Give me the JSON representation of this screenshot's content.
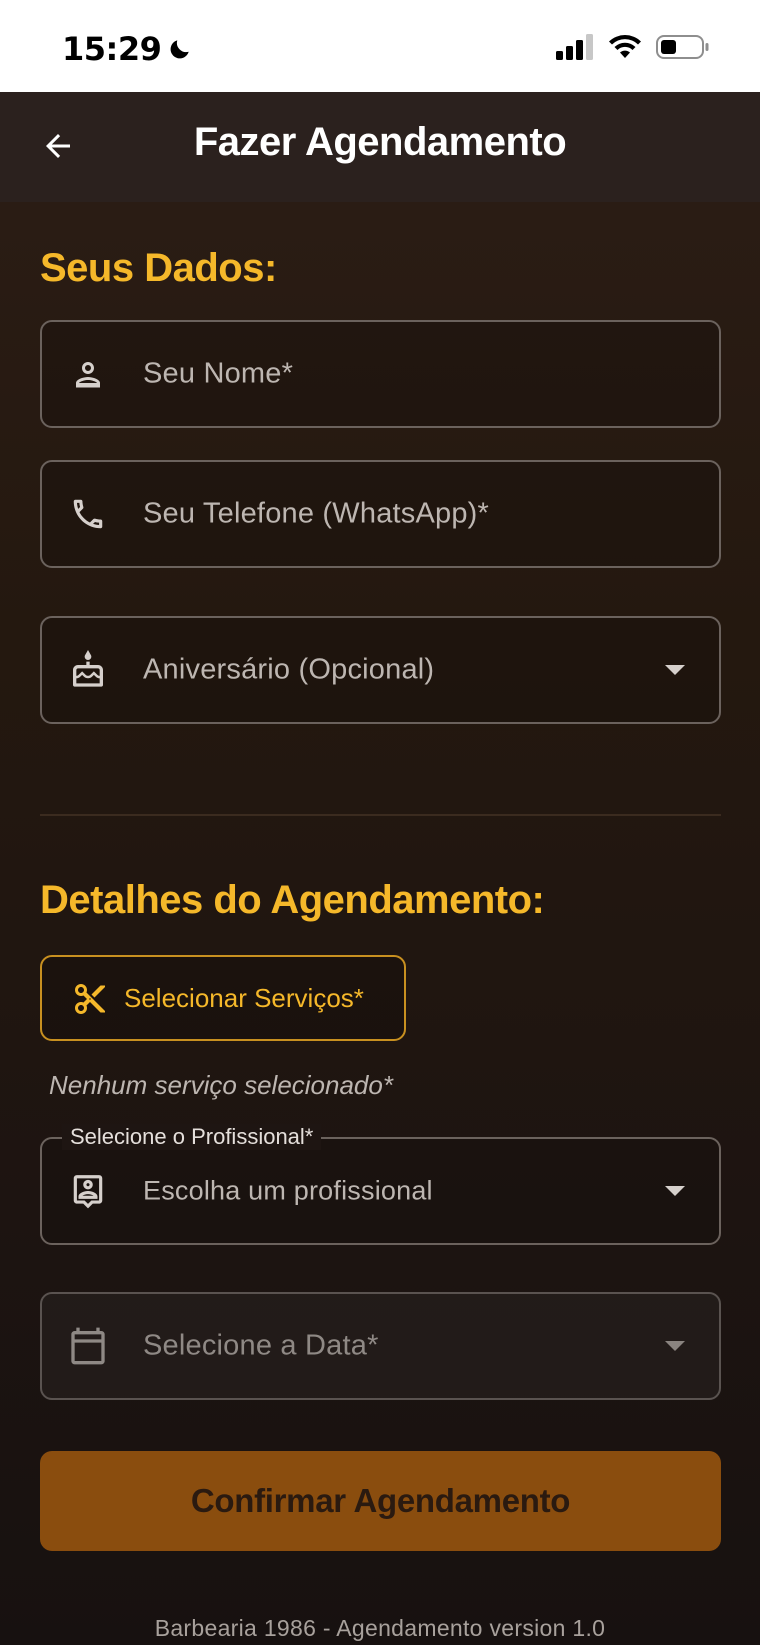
{
  "status_bar": {
    "time": "15:29"
  },
  "app_bar": {
    "title": "Fazer Agendamento"
  },
  "personal": {
    "section_title": "Seus Dados:",
    "name_placeholder": "Seu Nome*",
    "phone_placeholder": "Seu Telefone (WhatsApp)*",
    "birthday_placeholder": "Aniversário (Opcional)"
  },
  "booking": {
    "section_title": "Detalhes do Agendamento:",
    "services_button": "Selecionar Serviços*",
    "no_service_text": "Nenhum serviço selecionado*",
    "professional_label": "Selecione o Profissional*",
    "professional_value": "Escolha um profissional",
    "date_placeholder": "Selecione a Data*",
    "confirm_button": "Confirmar Agendamento"
  },
  "footer": {
    "text": "Barbearia 1986 - Agendamento version 1.0"
  },
  "colors": {
    "accent": "#f5b82a",
    "confirm": "#8a4d0e",
    "app_bar": "#2b211e"
  }
}
